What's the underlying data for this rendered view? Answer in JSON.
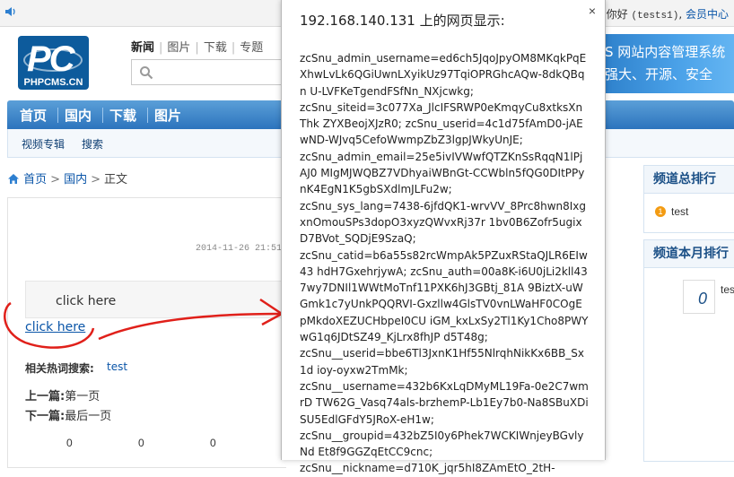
{
  "topbar": {
    "welcome_prefix": "你好",
    "username": "(tests1)",
    "separator": ",",
    "member_center": "会员中心"
  },
  "header": {
    "logo_text": "PC",
    "logo_domain": "PHPCMS.CN",
    "search_tabs": [
      "新闻",
      "图片",
      "下载",
      "专题"
    ],
    "search_placeholder": "",
    "brand_line1": "S 网站内容管理系统",
    "brand_line2": "强大、开源、安全"
  },
  "nav": {
    "main": [
      "首页",
      "国内",
      "下载",
      "图片"
    ],
    "sub": [
      "视频专辑",
      "搜索"
    ]
  },
  "breadcrumb": {
    "home": "首页",
    "category": "国内",
    "current": "正文"
  },
  "article": {
    "date": "2014-11-26 21:51",
    "quote_text": "click here",
    "link_text": "click here",
    "related_label": "相关热词搜索:",
    "related_link": "test",
    "prev_label": "上一篇:",
    "prev_value": "第一页",
    "next_label": "下一篇:",
    "next_value": "最后一页",
    "scores": [
      "0",
      "0",
      "0"
    ]
  },
  "sidebar": {
    "channel_total_title": "频道总排行",
    "channel_total_items": [
      {
        "rank": "1",
        "label": "test"
      }
    ],
    "channel_month_title": "频道本月排行",
    "month_count": "0",
    "month_item_truncated": "tes"
  },
  "alert": {
    "title": "192.168.140.131 上的网页显示:",
    "close_label": "×",
    "message_lines": [
      "zcSnu_admin_username=ed6ch5JqoJpyOM8MKqkPqE XhwLvLk6QGiUwnLXyikUz97TqiOPRGhcAQw-8dkQBqn U-LVFKeTgendFSfNn_NXjcwkg;",
      "zcSnu_siteid=3c077Xa_JlcIFSRWP0eKmqyCu8xtksXnThk ZYXBeojXJzR0; zcSnu_userid=4c1d75fAmD0-jAEwND-WJvq5CefoWwmpZbZ3lgpJWkyUnJE;",
      "zcSnu_admin_email=25e5ivIVWwfQTZKnSsRqqN1lPjAJ0 MIgMJWQBZ7VDhyaiWBnGt-CCWbln5fQG0DItPPynK4EgN1K5gbSXdlmJLFu2w;",
      "zcSnu_sys_lang=7438-6jfdQK1-wrvVV_8Prc8hwn8IxgxnOmouSPs3dopO3xyzQWvxRj37r 1bv0B6Zofr5ugixD7BVot_SQDjE9SzaQ;",
      "zcSnu_catid=b6a55s82rcWmpAk5PZuxRStaQJLR6EIw43 hdH7GxehrjywA; zcSnu_auth=00a8K-i6U0jLi2kll437wy7DNIl1WWtMoTnf11PXK6hJ3GBtj_81A 9BiztX-uWGmk1c7yUnkPQQRVI-Gxzllw4GlsTV0vnLWaHF0COgEpMkdoXEZUCHbpeI0CU iGM_kxLxSy2Tl1Ky1Cho8PWYwG1q6JDtSZ49_KjLrx8fhJP d5T48g;",
      "zcSnu__userid=bbe6Tl3JxnK1Hf55NlrqhNikKx6BB_Sx1d ioy-oyxw2TmMk;",
      "zcSnu__username=432b6KxLqDMyML19Fa-0e2C7wmrD TW62G_Vasq74als-brzhemP-Lb1Ey7b0-Na8SBuXDiSU5EdlGFdY5JRoX-eH1w;",
      "zcSnu__groupid=432bZ5I0y6Phek7WCKIWnjeyBGvlyNd Et8f9GGZqEtCC9cnc;",
      "zcSnu__nickname=d710K_jqr5hI8ZAmEtO_2tH-"
    ]
  },
  "colors": {
    "nav_blue": "#2c74bd",
    "link_blue": "#0a55a8",
    "annotation_red": "#e0201a",
    "rank_orange": "#f39b12"
  }
}
